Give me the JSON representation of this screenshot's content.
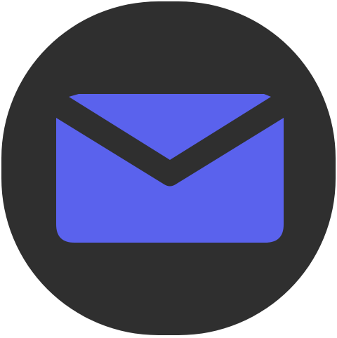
{
  "app_icon": {
    "icon": "mail-envelope-icon",
    "background_color": "#2f2f2f",
    "glyph_color": "#5a62ed"
  }
}
